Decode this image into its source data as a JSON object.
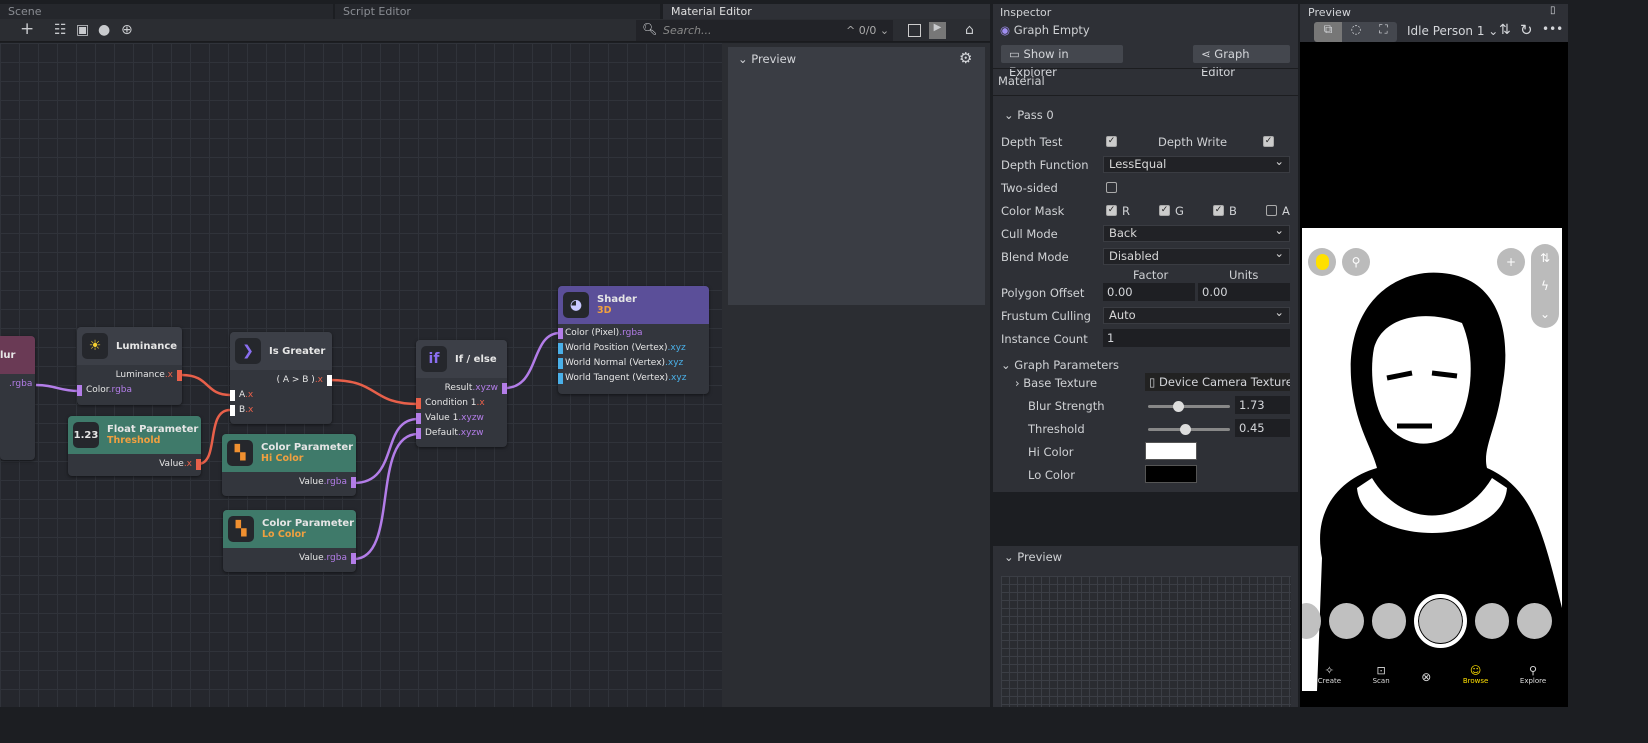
{
  "tabs": [
    {
      "label": "Scene"
    },
    {
      "label": "Script Editor"
    },
    {
      "label": "Material Editor"
    }
  ],
  "toolbar": {
    "search_placeholder": "Search...",
    "match_count": "0/0"
  },
  "graph": {
    "nodes": {
      "blur": {
        "title": "lur",
        "out": "rgba"
      },
      "luminance": {
        "title": "Luminance",
        "out_name": "Luminance",
        "out_type": ".x",
        "in_name": "Color",
        "in_type": ".rgba"
      },
      "float": {
        "title": "Float Parameter",
        "subtitle": "Threshold",
        "icon": "1.23",
        "out_name": "Value",
        "out_type": ".x"
      },
      "greater": {
        "title": "Is Greater",
        "out_name": "( A > B )",
        "out_type": ".x",
        "a_name": "A",
        "a_type": ".x",
        "b_name": "B",
        "b_type": ".x"
      },
      "hicolor": {
        "title": "Color Parameter",
        "subtitle": "Hi Color",
        "out_name": "Value",
        "out_type": ".rgba"
      },
      "locolor": {
        "title": "Color Parameter",
        "subtitle": "Lo Color",
        "out_name": "Value",
        "out_type": ".rgba"
      },
      "ifelse": {
        "title": "If / else",
        "icon": "if",
        "out_name": "Result",
        "out_type": ".xyzw",
        "inputs": [
          {
            "name": "Condition 1",
            "type": ".x"
          },
          {
            "name": "Value 1",
            "type": ".xyzw"
          },
          {
            "name": "Default",
            "type": ".xyzw"
          }
        ]
      },
      "shader": {
        "title": "Shader",
        "subtitle": "3D",
        "inputs": [
          {
            "name": "Color (Pixel)",
            "type": ".rgba"
          },
          {
            "name": "World Position (Vertex)",
            "type": ".xyz"
          },
          {
            "name": "World Normal (Vertex)",
            "type": ".xyz"
          },
          {
            "name": "World Tangent (Vertex)",
            "type": ".xyz"
          }
        ]
      }
    }
  },
  "material_preview": {
    "title": "Preview"
  },
  "inspector": {
    "title": "Inspector",
    "object": "Graph Empty",
    "show_in_explorer": "Show in Explorer",
    "graph_editor": "Graph Editor",
    "section": "Material",
    "pass": "Pass 0",
    "depth_test": "Depth Test",
    "depth_write": "Depth Write",
    "depth_function_label": "Depth Function",
    "depth_function": "LessEqual",
    "two_sided": "Two-sided",
    "color_mask": "Color Mask",
    "mask": [
      "R",
      "G",
      "B",
      "A"
    ],
    "cull_mode_label": "Cull Mode",
    "cull_mode": "Back",
    "blend_mode_label": "Blend Mode",
    "blend_mode": "Disabled",
    "factor": "Factor",
    "units": "Units",
    "polygon_offset": "Polygon Offset",
    "factor_value": "0.00",
    "units_value": "0.00",
    "frustum_label": "Frustum Culling",
    "frustum": "Auto",
    "instance_label": "Instance Count",
    "instance": "1",
    "graph_params": "Graph Parameters",
    "base_texture": "Base Texture",
    "base_texture_value": "Device Camera Texture",
    "blur_strength": "Blur Strength",
    "blur_value": "1.73",
    "threshold": "Threshold",
    "threshold_value": "0.45",
    "hi_color": "Hi Color",
    "lo_color": "Lo Color",
    "hi_color_value": "#ffffff",
    "lo_color_value": "#000000",
    "preview": "Preview"
  },
  "preview": {
    "title": "Preview",
    "person": "Idle Person 1",
    "nav": [
      "Create",
      "Scan",
      "Browse",
      "Explore"
    ]
  },
  "colors": {
    "accent_x": "#e8604a",
    "accent_rgba": "#b37de8",
    "accent_xyz": "#4ab0e8",
    "param_node": "#3f7a6a",
    "shader_node": "#5b4f99"
  }
}
